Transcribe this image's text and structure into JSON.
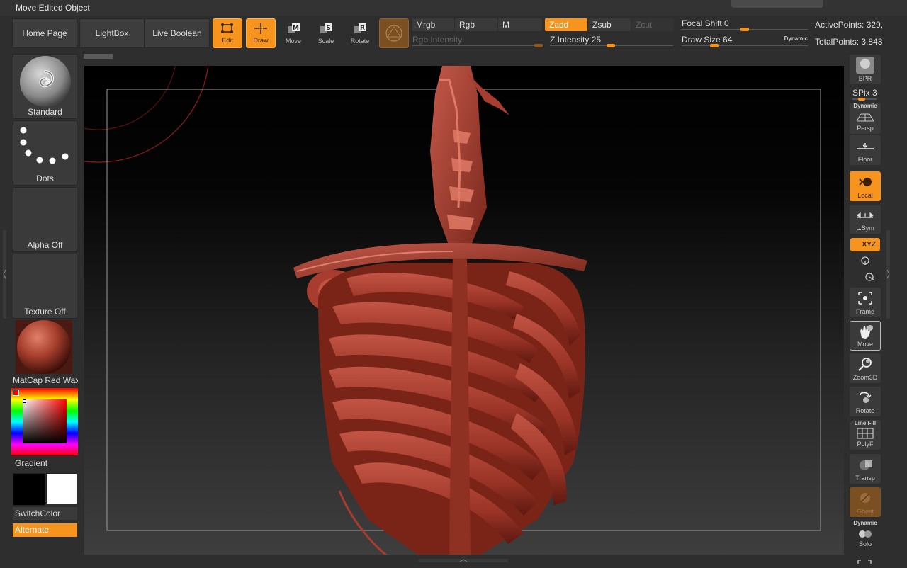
{
  "window": {
    "title": "Move Edited Object"
  },
  "nav": {
    "home": "Home Page",
    "lightbox": "LightBox",
    "live_boolean": "Live Boolean"
  },
  "tools": {
    "edit": "Edit",
    "draw": "Draw",
    "move": "Move",
    "scale": "Scale",
    "rotate": "Rotate",
    "move_key": "M",
    "scale_key": "S",
    "rotate_key": "R"
  },
  "modes": {
    "mrgb": "Mrgb",
    "rgb": "Rgb",
    "m": "M",
    "zadd": "Zadd",
    "zsub": "Zsub",
    "zcut": "Zcut"
  },
  "sliders": {
    "rgb_intensity": "Rgb Intensity",
    "z_intensity": "Z Intensity 25",
    "focal_shift": "Focal Shift 0",
    "draw_size": "Draw Size 64",
    "dynamic": "Dynamic"
  },
  "stats": {
    "active_points": "ActivePoints: 329,",
    "total_points": "TotalPoints: 3.843"
  },
  "left": {
    "brush": "Standard",
    "stroke": "Dots",
    "alpha": "Alpha Off",
    "texture": "Texture Off",
    "material": "MatCap Red Wax",
    "gradient": "Gradient",
    "switch_color": "SwitchColor",
    "alternate": "Alternate"
  },
  "right": {
    "bpr": "BPR",
    "spix": "SPix 3",
    "persp": "Persp",
    "persp_top": "Dynamic",
    "floor": "Floor",
    "local": "Local",
    "lsym": "L.Sym",
    "xyz": "XYZ",
    "frame": "Frame",
    "move": "Move",
    "zoom3d": "Zoom3D",
    "rotate": "Rotate",
    "polyf": "PolyF",
    "polyf_top": "Line Fill",
    "transp": "Transp",
    "ghost": "Ghost",
    "solo": "Solo",
    "solo_top": "Dynamic"
  },
  "colors": {
    "accent": "#f7941d",
    "model": "#b0473a",
    "background": "#2e2e2e"
  }
}
